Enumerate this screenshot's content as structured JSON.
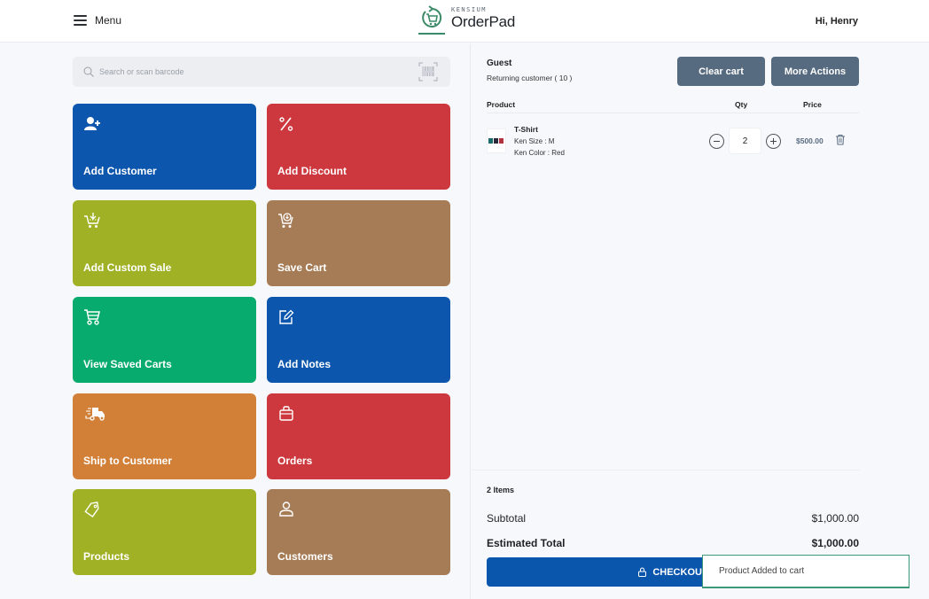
{
  "header": {
    "menu_label": "Menu",
    "logo_small": "KENSIUM",
    "logo_big": "OrderPad",
    "greeting": "Hi, Henry",
    "brand_color": "#3c8a67"
  },
  "search": {
    "placeholder": "Search or scan barcode",
    "value": ""
  },
  "tiles": [
    {
      "label": "Add Customer",
      "icon": "add-user-icon",
      "color": "#0c56ad"
    },
    {
      "label": "Add Discount",
      "icon": "percent-icon",
      "color": "#cc383d"
    },
    {
      "label": "Add Custom Sale",
      "icon": "cart-add-icon",
      "color": "#a0b126"
    },
    {
      "label": "Save Cart",
      "icon": "cart-save-icon",
      "color": "#a67c56"
    },
    {
      "label": "View Saved Carts",
      "icon": "cart-icon",
      "color": "#06ab6d"
    },
    {
      "label": "Add Notes",
      "icon": "edit-note-icon",
      "color": "#0c56ad"
    },
    {
      "label": "Ship to Customer",
      "icon": "truck-icon",
      "color": "#d28037"
    },
    {
      "label": "Orders",
      "icon": "bag-icon",
      "color": "#cc383d"
    },
    {
      "label": "Products",
      "icon": "tag-icon",
      "color": "#a0b126"
    },
    {
      "label": "Customers",
      "icon": "user-icon",
      "color": "#a67c56"
    }
  ],
  "customer": {
    "name": "Guest",
    "subtitle": "Returning customer ( 10 )"
  },
  "actions": {
    "clear_cart": "Clear cart",
    "more_actions": "More Actions"
  },
  "cart": {
    "columns": [
      "Product",
      "Qty",
      "Price"
    ],
    "items": [
      {
        "name": "T-Shirt",
        "options": [
          "Ken Size : M",
          "Ken Color : Red"
        ],
        "qty": "2",
        "price": "$500.00"
      }
    ]
  },
  "summary": {
    "items_count": "2 Items",
    "subtotal_label": "Subtotal",
    "subtotal_value": "$1,000.00",
    "total_label": "Estimated Total",
    "total_value": "$1,000.00",
    "checkout_label": "CHECKOUT"
  },
  "toast": {
    "message": "Product Added to cart"
  }
}
